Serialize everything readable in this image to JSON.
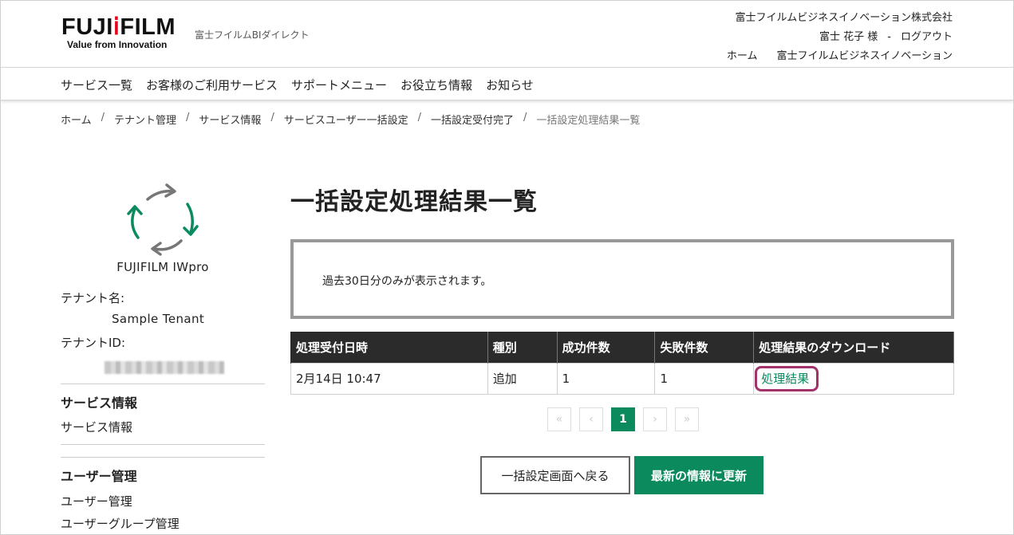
{
  "header": {
    "logo_text_1": "FUJI",
    "logo_text_2": "FILM",
    "logo_tagline": "Value from Innovation",
    "site_name": "富士フイルムBIダイレクト",
    "company": "富士フイルムビジネスイノベーション株式会社",
    "user_name": "富士 花子 様",
    "separator": "-",
    "logout": "ログアウト",
    "home_link": "ホーム",
    "corp_link": "富士フイルムビジネスイノベーション"
  },
  "nav": {
    "items": [
      "サービス一覧",
      "お客様のご利用サービス",
      "サポートメニュー",
      "お役立ち情報",
      "お知らせ"
    ]
  },
  "breadcrumb": {
    "items": [
      "ホーム",
      "テナント管理",
      "サービス情報",
      "サービスユーザー一括設定",
      "一括設定受付完了"
    ],
    "current": "一括設定処理結果一覧"
  },
  "sidebar": {
    "service_icon": "sync-arrows-icon",
    "service_name": "FUJIFILM IWpro",
    "tenant_name_label": "テナント名:",
    "tenant_name_value": "Sample Tenant",
    "tenant_id_label": "テナントID:",
    "sections": [
      {
        "heading": "サービス情報",
        "links": [
          "サービス情報"
        ]
      },
      {
        "heading": "ユーザー管理",
        "links": [
          "ユーザー管理",
          "ユーザーグループ管理"
        ]
      }
    ]
  },
  "main": {
    "title": "一括設定処理結果一覧",
    "notice": "過去30日分のみが表示されます。",
    "table": {
      "headers": [
        "処理受付日時",
        "種別",
        "成功件数",
        "失敗件数",
        "処理結果のダウンロード"
      ],
      "rows": [
        {
          "datetime": "2月14日 10:47",
          "type": "追加",
          "success": "1",
          "failure": "1",
          "download": "処理結果"
        }
      ]
    },
    "pager": {
      "first": "«",
      "prev": "‹",
      "current": "1",
      "next": "›",
      "last": "»"
    },
    "buttons": {
      "back": "一括設定画面へ戻る",
      "refresh": "最新の情報に更新"
    }
  },
  "colors": {
    "accent": "#0b8a5e",
    "highlight": "#a3326b",
    "header_bg": "#2b2b2b"
  }
}
